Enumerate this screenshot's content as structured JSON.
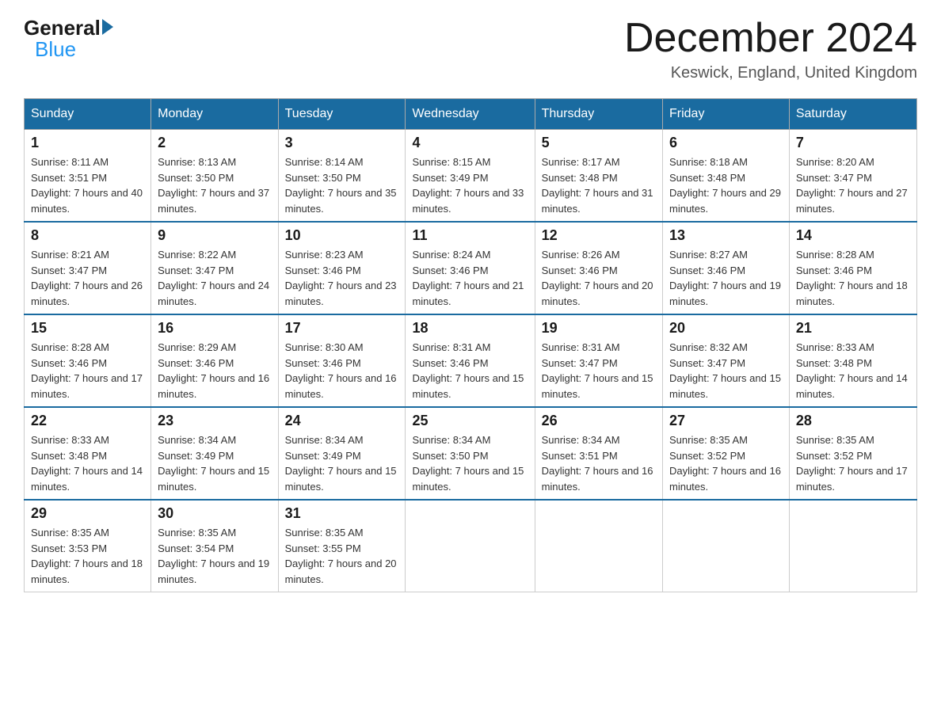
{
  "header": {
    "logo_general": "General",
    "logo_blue": "Blue",
    "month_title": "December 2024",
    "location": "Keswick, England, United Kingdom"
  },
  "days_of_week": [
    "Sunday",
    "Monday",
    "Tuesday",
    "Wednesday",
    "Thursday",
    "Friday",
    "Saturday"
  ],
  "weeks": [
    [
      {
        "day": "1",
        "sunrise": "8:11 AM",
        "sunset": "3:51 PM",
        "daylight": "7 hours and 40 minutes."
      },
      {
        "day": "2",
        "sunrise": "8:13 AM",
        "sunset": "3:50 PM",
        "daylight": "7 hours and 37 minutes."
      },
      {
        "day": "3",
        "sunrise": "8:14 AM",
        "sunset": "3:50 PM",
        "daylight": "7 hours and 35 minutes."
      },
      {
        "day": "4",
        "sunrise": "8:15 AM",
        "sunset": "3:49 PM",
        "daylight": "7 hours and 33 minutes."
      },
      {
        "day": "5",
        "sunrise": "8:17 AM",
        "sunset": "3:48 PM",
        "daylight": "7 hours and 31 minutes."
      },
      {
        "day": "6",
        "sunrise": "8:18 AM",
        "sunset": "3:48 PM",
        "daylight": "7 hours and 29 minutes."
      },
      {
        "day": "7",
        "sunrise": "8:20 AM",
        "sunset": "3:47 PM",
        "daylight": "7 hours and 27 minutes."
      }
    ],
    [
      {
        "day": "8",
        "sunrise": "8:21 AM",
        "sunset": "3:47 PM",
        "daylight": "7 hours and 26 minutes."
      },
      {
        "day": "9",
        "sunrise": "8:22 AM",
        "sunset": "3:47 PM",
        "daylight": "7 hours and 24 minutes."
      },
      {
        "day": "10",
        "sunrise": "8:23 AM",
        "sunset": "3:46 PM",
        "daylight": "7 hours and 23 minutes."
      },
      {
        "day": "11",
        "sunrise": "8:24 AM",
        "sunset": "3:46 PM",
        "daylight": "7 hours and 21 minutes."
      },
      {
        "day": "12",
        "sunrise": "8:26 AM",
        "sunset": "3:46 PM",
        "daylight": "7 hours and 20 minutes."
      },
      {
        "day": "13",
        "sunrise": "8:27 AM",
        "sunset": "3:46 PM",
        "daylight": "7 hours and 19 minutes."
      },
      {
        "day": "14",
        "sunrise": "8:28 AM",
        "sunset": "3:46 PM",
        "daylight": "7 hours and 18 minutes."
      }
    ],
    [
      {
        "day": "15",
        "sunrise": "8:28 AM",
        "sunset": "3:46 PM",
        "daylight": "7 hours and 17 minutes."
      },
      {
        "day": "16",
        "sunrise": "8:29 AM",
        "sunset": "3:46 PM",
        "daylight": "7 hours and 16 minutes."
      },
      {
        "day": "17",
        "sunrise": "8:30 AM",
        "sunset": "3:46 PM",
        "daylight": "7 hours and 16 minutes."
      },
      {
        "day": "18",
        "sunrise": "8:31 AM",
        "sunset": "3:46 PM",
        "daylight": "7 hours and 15 minutes."
      },
      {
        "day": "19",
        "sunrise": "8:31 AM",
        "sunset": "3:47 PM",
        "daylight": "7 hours and 15 minutes."
      },
      {
        "day": "20",
        "sunrise": "8:32 AM",
        "sunset": "3:47 PM",
        "daylight": "7 hours and 15 minutes."
      },
      {
        "day": "21",
        "sunrise": "8:33 AM",
        "sunset": "3:48 PM",
        "daylight": "7 hours and 14 minutes."
      }
    ],
    [
      {
        "day": "22",
        "sunrise": "8:33 AM",
        "sunset": "3:48 PM",
        "daylight": "7 hours and 14 minutes."
      },
      {
        "day": "23",
        "sunrise": "8:34 AM",
        "sunset": "3:49 PM",
        "daylight": "7 hours and 15 minutes."
      },
      {
        "day": "24",
        "sunrise": "8:34 AM",
        "sunset": "3:49 PM",
        "daylight": "7 hours and 15 minutes."
      },
      {
        "day": "25",
        "sunrise": "8:34 AM",
        "sunset": "3:50 PM",
        "daylight": "7 hours and 15 minutes."
      },
      {
        "day": "26",
        "sunrise": "8:34 AM",
        "sunset": "3:51 PM",
        "daylight": "7 hours and 16 minutes."
      },
      {
        "day": "27",
        "sunrise": "8:35 AM",
        "sunset": "3:52 PM",
        "daylight": "7 hours and 16 minutes."
      },
      {
        "day": "28",
        "sunrise": "8:35 AM",
        "sunset": "3:52 PM",
        "daylight": "7 hours and 17 minutes."
      }
    ],
    [
      {
        "day": "29",
        "sunrise": "8:35 AM",
        "sunset": "3:53 PM",
        "daylight": "7 hours and 18 minutes."
      },
      {
        "day": "30",
        "sunrise": "8:35 AM",
        "sunset": "3:54 PM",
        "daylight": "7 hours and 19 minutes."
      },
      {
        "day": "31",
        "sunrise": "8:35 AM",
        "sunset": "3:55 PM",
        "daylight": "7 hours and 20 minutes."
      },
      null,
      null,
      null,
      null
    ]
  ]
}
